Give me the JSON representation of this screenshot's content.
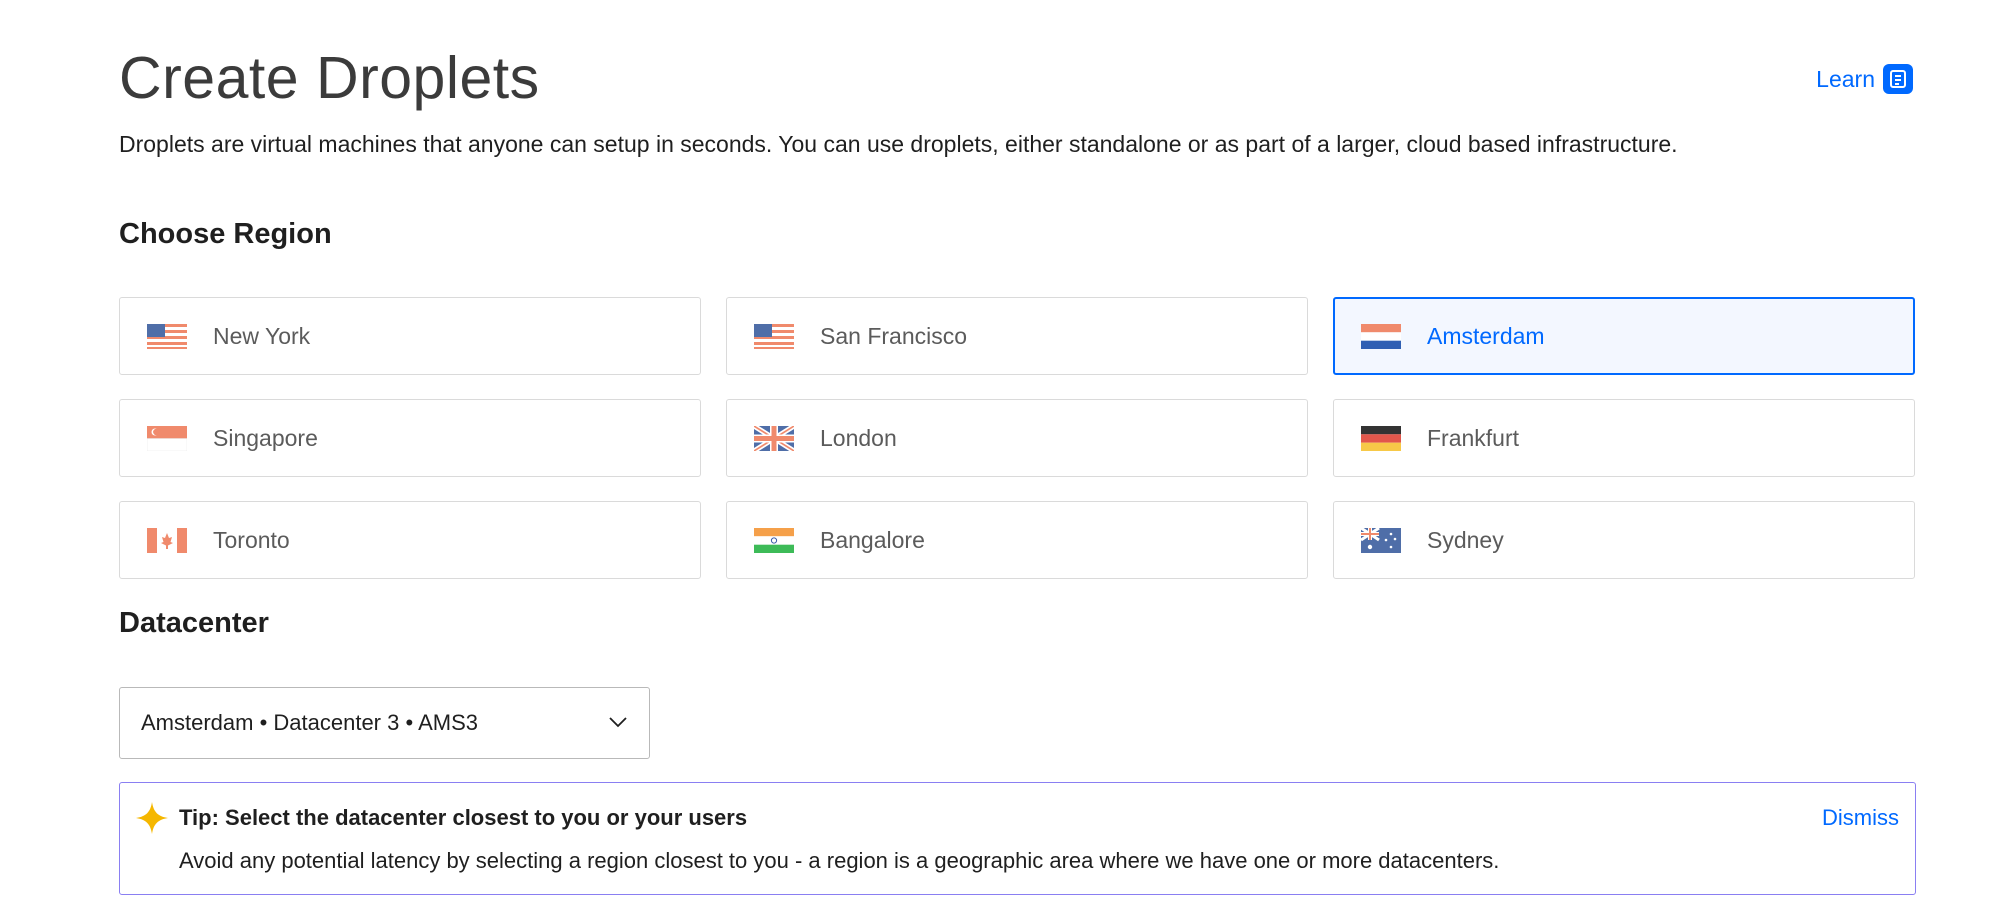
{
  "header": {
    "title": "Create Droplets",
    "learn_label": "Learn",
    "learn_icon": "document-icon",
    "intro": "Droplets are virtual machines that anyone can setup in seconds. You can use droplets, either standalone or as part of a larger, cloud based infrastructure."
  },
  "region": {
    "title": "Choose Region",
    "selected": "Amsterdam",
    "items": [
      {
        "label": "New York",
        "flag": "us-flag-icon"
      },
      {
        "label": "San Francisco",
        "flag": "us-flag-icon"
      },
      {
        "label": "Amsterdam",
        "flag": "netherlands-flag-icon"
      },
      {
        "label": "Singapore",
        "flag": "singapore-flag-icon"
      },
      {
        "label": "London",
        "flag": "uk-flag-icon"
      },
      {
        "label": "Frankfurt",
        "flag": "germany-flag-icon"
      },
      {
        "label": "Toronto",
        "flag": "canada-flag-icon"
      },
      {
        "label": "Bangalore",
        "flag": "india-flag-icon"
      },
      {
        "label": "Sydney",
        "flag": "australia-flag-icon"
      }
    ]
  },
  "datacenter": {
    "title": "Datacenter",
    "selected_value": "Amsterdam • Datacenter 3 • AMS3"
  },
  "tip": {
    "title": "Tip: Select the datacenter closest to you or your users",
    "body": "Avoid any potential latency by selecting a region closest to you - a region is a geographic area where we have one or more datacenters.",
    "dismiss_label": "Dismiss",
    "icon": "sparkle-icon"
  },
  "colors": {
    "accent": "#0069ff",
    "tip_border": "#8a7ff2",
    "sparkle": "#f5b700"
  }
}
